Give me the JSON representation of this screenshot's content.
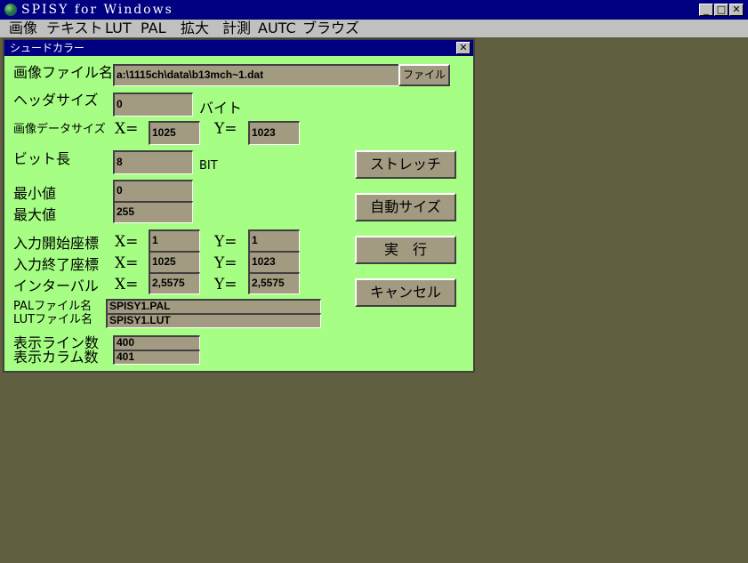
{
  "window": {
    "title": "SPISY for Windows",
    "minimize_glyph": "_",
    "maximize_glyph": "□",
    "close_glyph": "✕"
  },
  "menu": {
    "items": [
      "画像",
      "テキスト",
      "LUT",
      "PAL",
      "拡大",
      "計測",
      "AUTC",
      "ブラウズ"
    ]
  },
  "dialog": {
    "title": "シュードカラー",
    "close_glyph": "✕",
    "image_file_label": "画像ファイル名",
    "image_file_value": "a:\\1115ch\\data\\b13mch~1.dat",
    "file_button": "ファイル",
    "header_size_label": "ヘッダサイズ",
    "header_size_value": "0",
    "header_size_unit": "バイト",
    "data_size_label": "画像データサイズ",
    "data_size_x_label": "X=",
    "data_size_x": "1025",
    "data_size_y_label": "Y=",
    "data_size_y": "1023",
    "bit_length_label": "ビット長",
    "bit_length_value": "8",
    "bit_length_unit": "BIT",
    "min_label": "最小値",
    "min_value": "0",
    "max_label": "最大値",
    "max_value": "255",
    "start_coord_label": "入力開始座標",
    "start_x_label": "X=",
    "start_x": "1",
    "start_y_label": "Y=",
    "start_y": "1",
    "end_coord_label": "入力終了座標",
    "end_x_label": "X=",
    "end_x": "1025",
    "end_y_label": "Y=",
    "end_y": "1023",
    "interval_label": "インターバル",
    "interval_x_label": "X=",
    "interval_x": "2,5575",
    "interval_y_label": "Y=",
    "interval_y": "2,5575",
    "pal_label": "PALファイル名",
    "pal_value": "SPISY1.PAL",
    "lut_label": "LUTファイル名",
    "lut_value": "SPISY1.LUT",
    "lines_label": "表示ライン数",
    "lines_value": "400",
    "cols_label": "表示カラム数",
    "cols_value": "401",
    "stretch_button": "ストレッチ",
    "autosize_button": "自動サイズ",
    "execute_button": "実　行",
    "cancel_button": "キャンセル"
  },
  "colors": {
    "titlebar": "#000080",
    "dialog_bg": "#a6ff84",
    "field_bg": "#a39b81",
    "workspace": "#606040"
  }
}
